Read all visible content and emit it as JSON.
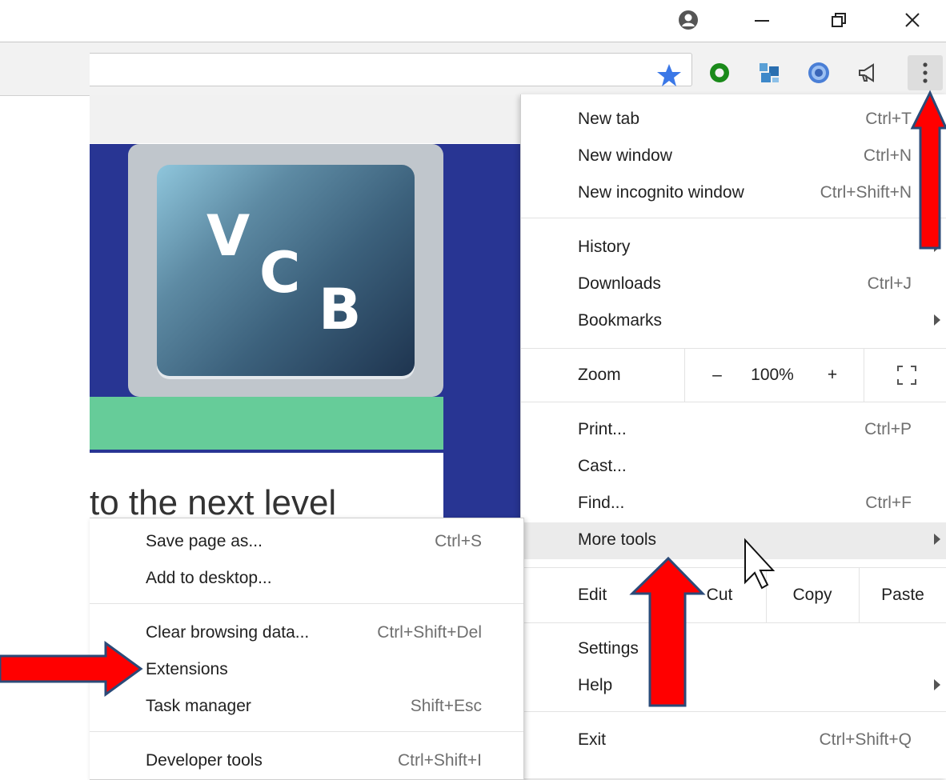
{
  "window": {
    "controls": [
      {
        "name": "profile-icon",
        "glyph": "☻"
      },
      {
        "name": "minimize-icon",
        "glyph": "—"
      },
      {
        "name": "restore-icon",
        "glyph": "❐"
      },
      {
        "name": "close-icon",
        "glyph": "✕"
      }
    ]
  },
  "toolbar": {
    "bookmark_star_color": "#3b78e7",
    "extensions": [
      "green-ring-extension-icon",
      "blue-puzzle-extension-icon",
      "blue-globe-extension-icon",
      "megaphone-extension-icon"
    ],
    "menu_icon": "more-vert-icon"
  },
  "page": {
    "logo": {
      "letters": [
        "V",
        "C",
        "B"
      ]
    },
    "headline": "to the next level",
    "colors": {
      "background": "#283593",
      "band": "#66cc99"
    }
  },
  "main_menu": {
    "new_tab": {
      "label": "New tab",
      "shortcut": "Ctrl+T"
    },
    "new_window": {
      "label": "New window",
      "shortcut": "Ctrl+N"
    },
    "incognito": {
      "label": "New incognito window",
      "shortcut": "Ctrl+Shift+N"
    },
    "history": {
      "label": "History"
    },
    "downloads": {
      "label": "Downloads",
      "shortcut": "Ctrl+J"
    },
    "bookmarks": {
      "label": "Bookmarks"
    },
    "zoom": {
      "label": "Zoom",
      "minus": "–",
      "value": "100%",
      "plus": "+"
    },
    "print": {
      "label": "Print...",
      "shortcut": "Ctrl+P"
    },
    "cast": {
      "label": "Cast..."
    },
    "find": {
      "label": "Find...",
      "shortcut": "Ctrl+F"
    },
    "more_tools": {
      "label": "More tools"
    },
    "edit": {
      "label": "Edit",
      "cut": "Cut",
      "copy": "Copy",
      "paste": "Paste"
    },
    "settings": {
      "label": "Settings"
    },
    "help": {
      "label": "Help"
    },
    "exit": {
      "label": "Exit",
      "shortcut": "Ctrl+Shift+Q"
    }
  },
  "more_tools_menu": {
    "save_page": {
      "label": "Save page as...",
      "shortcut": "Ctrl+S"
    },
    "add_desktop": {
      "label": "Add to desktop..."
    },
    "clear_data": {
      "label": "Clear browsing data...",
      "shortcut": "Ctrl+Shift+Del"
    },
    "extensions": {
      "label": "Extensions"
    },
    "task_manager": {
      "label": "Task manager",
      "shortcut": "Shift+Esc"
    },
    "dev_tools": {
      "label": "Developer tools",
      "shortcut": "Ctrl+Shift+I"
    }
  },
  "annotations": {
    "arrow_color": "#ff0000",
    "arrow_outline": "#2b4a78"
  }
}
